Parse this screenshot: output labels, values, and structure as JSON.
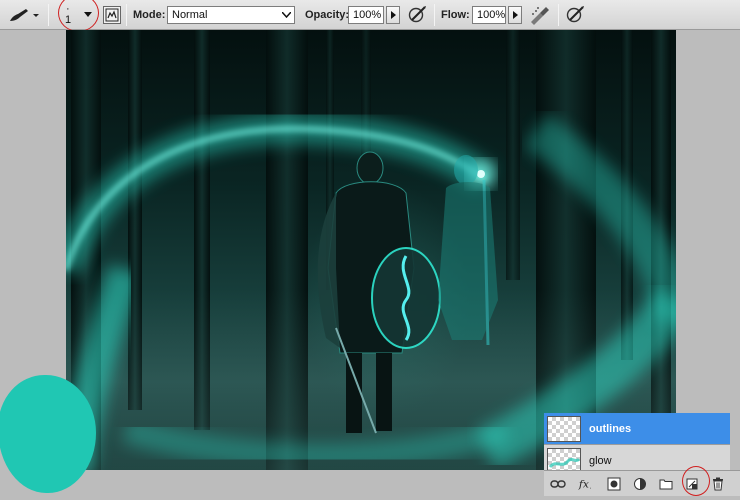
{
  "toolbar": {
    "brush_size_top": "·",
    "brush_size_value": "1",
    "mode_label": "Mode:",
    "mode_value": "Normal",
    "opacity_label": "Opacity:",
    "opacity_value": "100%",
    "flow_label": "Flow:",
    "flow_value": "100%"
  },
  "layers": [
    {
      "name": "outlines",
      "selected": true
    },
    {
      "name": "glow",
      "selected": false
    }
  ],
  "colors": {
    "accent": "#3d8ee8",
    "swatch": "#20c7b3",
    "glow": "#2fe6d0",
    "annotation": "#d02020"
  },
  "panel_icons": [
    "link-icon",
    "fx-icon",
    "mask-icon",
    "adjustment-icon",
    "folder-icon",
    "new-layer-icon",
    "trash-icon"
  ]
}
